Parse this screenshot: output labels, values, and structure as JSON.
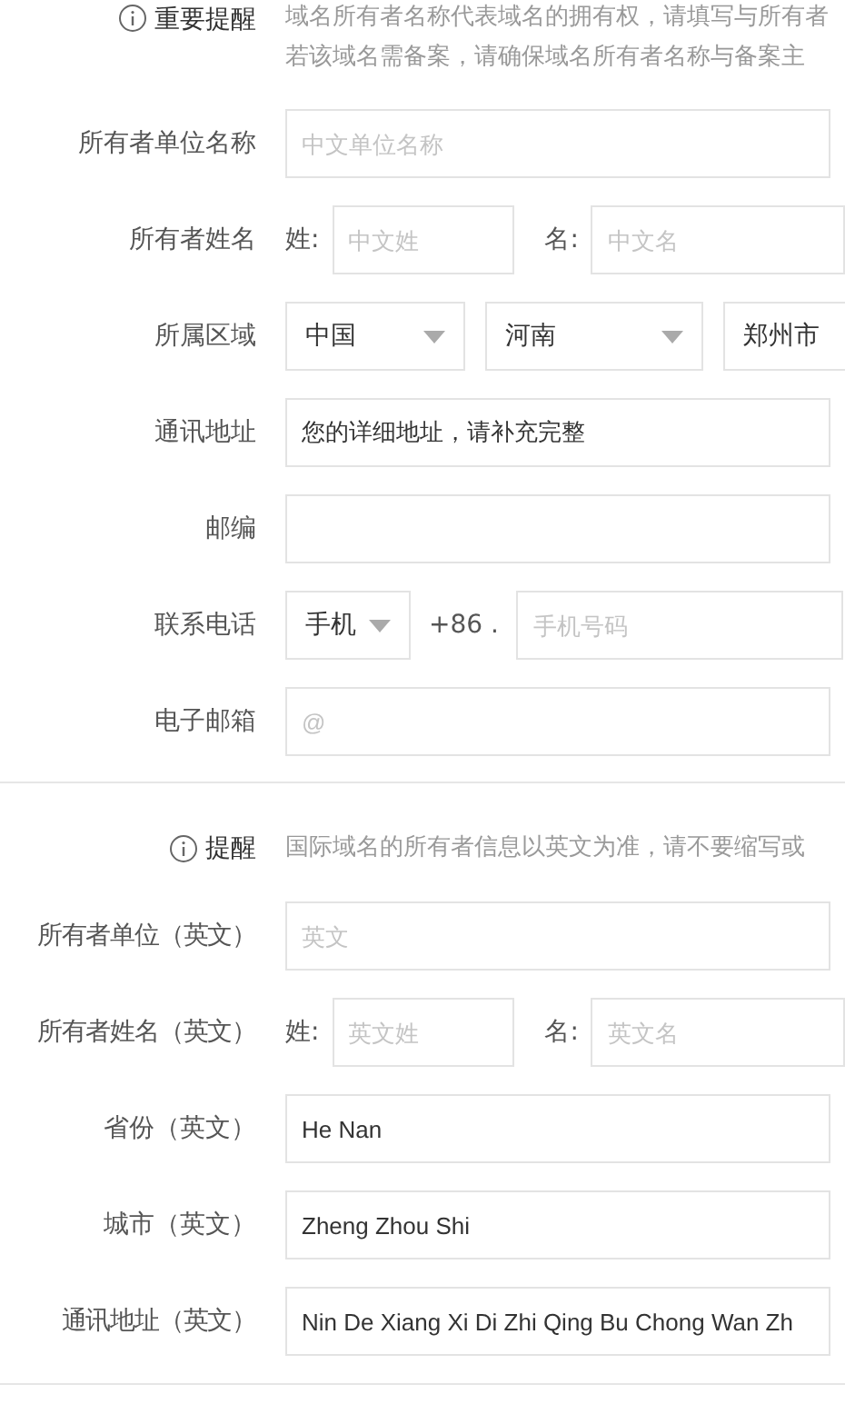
{
  "notice": {
    "label": "重要提醒",
    "lines": [
      "域名所有者名称代表域名的拥有权，请填写与所有者",
      "若该域名需备案，请确保域名所有者名称与备案主"
    ]
  },
  "section_cn": [
    {
      "kind": "text",
      "label": "所有者单位名称",
      "placeholder": "中文单位名称"
    },
    {
      "kind": "name",
      "label": "所有者姓名",
      "last_label": "姓:",
      "last_placeholder": "中文姓",
      "first_label": "名:",
      "first_placeholder": "中文名"
    },
    {
      "kind": "region",
      "label": "所属区域",
      "selects": [
        "中国",
        "河南",
        "郑州市"
      ]
    },
    {
      "kind": "text",
      "label": "通讯地址",
      "value": "您的详细地址，请补充完整"
    },
    {
      "kind": "text",
      "label": "邮编"
    },
    {
      "kind": "phone",
      "label": "联系电话",
      "select": "手机",
      "code": "+86 .",
      "placeholder": "手机号码"
    },
    {
      "kind": "text",
      "label": "电子邮箱",
      "placeholder": "@"
    }
  ],
  "reminder": {
    "label": "提醒",
    "text": "国际域名的所有者信息以英文为准，请不要缩写或"
  },
  "section_en": [
    {
      "kind": "text",
      "label": "所有者单位（英文）",
      "placeholder": "英文"
    },
    {
      "kind": "name",
      "label": "所有者姓名（英文）",
      "last_label": "姓:",
      "last_placeholder": "英文姓",
      "first_label": "名:",
      "first_placeholder": "英文名"
    },
    {
      "kind": "text",
      "label": "省份（英文）",
      "value": "He Nan"
    },
    {
      "kind": "text",
      "label": "城市（英文）",
      "value": "Zheng Zhou Shi"
    },
    {
      "kind": "text",
      "label": "通讯地址（英文）",
      "value": "Nin De Xiang Xi Di Zhi Qing Bu Chong Wan Zh"
    }
  ]
}
